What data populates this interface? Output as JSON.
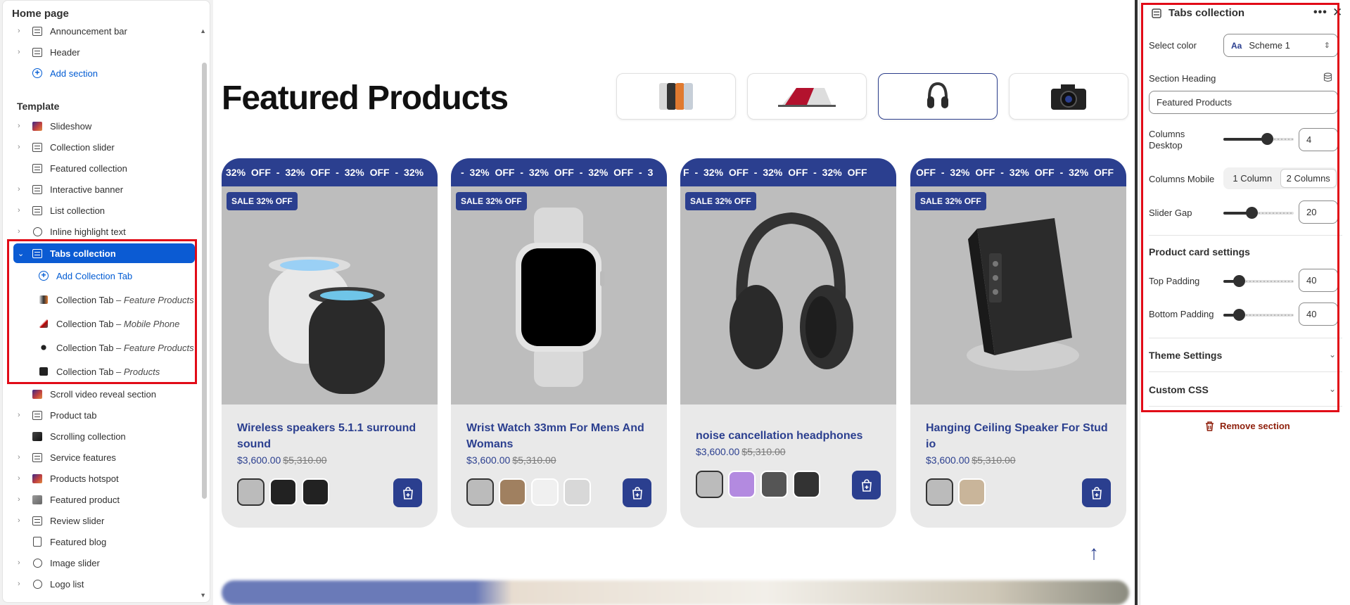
{
  "sidebar": {
    "title": "Home page",
    "header_group": [
      {
        "label": "Announcement bar",
        "icon": "section-icon"
      },
      {
        "label": "Header",
        "icon": "section-icon"
      }
    ],
    "add_section_top": "Add section",
    "template_label": "Template",
    "items": [
      {
        "label": "Slideshow",
        "icon": "image-icon",
        "chevron": true
      },
      {
        "label": "Collection slider",
        "icon": "section-icon",
        "chevron": true
      },
      {
        "label": "Featured collection",
        "icon": "section-icon",
        "chevron": false
      },
      {
        "label": "Interactive banner",
        "icon": "section-icon",
        "chevron": true
      },
      {
        "label": "List collection",
        "icon": "section-icon",
        "chevron": true
      },
      {
        "label": "Inline highlight text",
        "icon": "text-icon",
        "chevron": true
      },
      {
        "label": "Tabs collection",
        "icon": "section-icon",
        "chevron": true,
        "active": true
      }
    ],
    "sub_items": {
      "add": "Add Collection Tab",
      "tabs": [
        {
          "label": "Collection Tab",
          "suffix": "– Feature Products"
        },
        {
          "label": "Collection Tab",
          "suffix": "– Mobile Phone"
        },
        {
          "label": "Collection Tab",
          "suffix": "– Feature Products"
        },
        {
          "label": "Collection Tab",
          "suffix": "– Products"
        }
      ]
    },
    "items_after": [
      {
        "label": "Scroll video reveal section",
        "icon": "image-icon",
        "chevron": false
      },
      {
        "label": "Product tab",
        "icon": "section-icon",
        "chevron": true
      },
      {
        "label": "Scrolling collection",
        "icon": "image-icon",
        "chevron": false
      },
      {
        "label": "Service features",
        "icon": "section-icon",
        "chevron": true
      },
      {
        "label": "Products hotspot",
        "icon": "image-icon",
        "chevron": true
      },
      {
        "label": "Featured product",
        "icon": "image-icon",
        "chevron": true
      },
      {
        "label": "Review slider",
        "icon": "section-icon",
        "chevron": true
      },
      {
        "label": "Featured blog",
        "icon": "blog-icon",
        "chevron": false
      },
      {
        "label": "Image slider",
        "icon": "section-icon",
        "chevron": true
      },
      {
        "label": "Logo list",
        "icon": "section-icon",
        "chevron": true
      }
    ]
  },
  "canvas": {
    "heading": "Featured Products",
    "marquee_text": "32% OFF  -  32% OFF  -  32% OFF  -  32% OFF  -  32% OFF",
    "products": [
      {
        "name": "Wireless speakers 5.1.1 surround sound",
        "price": "$3,600.00",
        "compare": "$5,310.00",
        "badge": "SALE 32% OFF",
        "marquee": "32% OFF   - 32% OFF   - 32% OFF   - 32%"
      },
      {
        "name": "Wrist Watch 33mm For Mens And Womans",
        "price": "$3,600.00",
        "compare": "$5,310.00",
        "badge": "SALE 32% OFF",
        "marquee": "- 32% OFF   - 32% OFF   - 32% OFF   - 3"
      },
      {
        "name": "noise cancellation headphones",
        "price": "$3,600.00",
        "compare": "$5,310.00",
        "badge": "SALE 32% OFF",
        "marquee": "F   - 32% OFF   - 32% OFF   - 32% OFF"
      },
      {
        "name": "Hanging Ceiling Speaker For Stud io",
        "price": "$3,600.00",
        "compare": "$5,310.00",
        "badge": "SALE 32% OFF",
        "marquee": "OFF   - 32% OFF   - 32% OFF   - 32% OFF"
      }
    ]
  },
  "settings": {
    "title": "Tabs collection",
    "select_color_label": "Select color",
    "select_color_value": "Scheme 1",
    "section_heading_label": "Section Heading",
    "section_heading_value": "Featured Products",
    "columns_desktop_label_1": "Columns",
    "columns_desktop_label_2": "Desktop",
    "columns_desktop_value": "4",
    "columns_mobile_label": "Columns Mobile",
    "columns_mobile_options": [
      "1 Column",
      "2 Columns"
    ],
    "slider_gap_label": "Slider Gap",
    "slider_gap_value": "20",
    "product_card_heading": "Product card settings",
    "top_padding_label": "Top Padding",
    "top_padding_value": "40",
    "bottom_padding_label": "Bottom Padding",
    "bottom_padding_value": "40",
    "theme_settings": "Theme Settings",
    "custom_css": "Custom CSS",
    "remove_section": "Remove section"
  },
  "colors": {
    "accent": "#2b3f8f",
    "active": "#0b5bd3",
    "highlight": "#e10b17",
    "remove": "#8e1f0b"
  }
}
